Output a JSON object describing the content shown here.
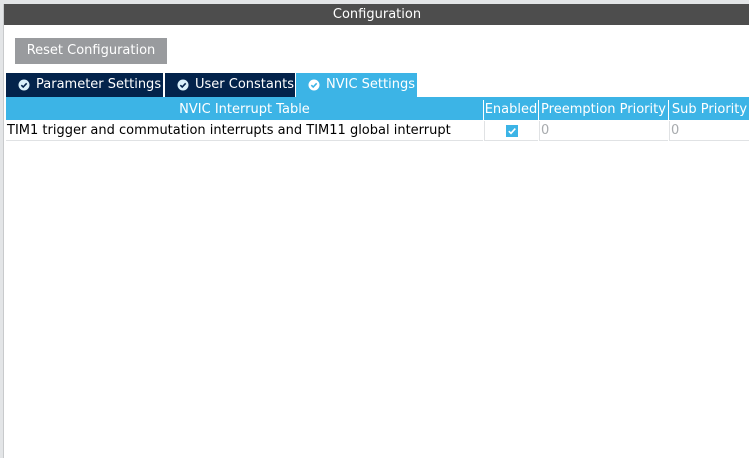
{
  "window": {
    "title": "Configuration"
  },
  "toolbar": {
    "reset_label": "Reset Configuration"
  },
  "tabs": [
    {
      "label": "Parameter Settings",
      "active": false,
      "icon": "check-circle-icon"
    },
    {
      "label": "User Constants",
      "active": false,
      "icon": "check-circle-icon"
    },
    {
      "label": "NVIC Settings",
      "active": true,
      "icon": "check-circle-icon"
    }
  ],
  "table": {
    "columns": [
      "NVIC Interrupt Table",
      "Enabled",
      "Preemption Priority",
      "Sub Priority"
    ],
    "rows": [
      {
        "name": "TIM1 trigger and commutation interrupts and TIM11 global interrupt",
        "enabled": true,
        "preemption_priority": "0",
        "sub_priority": "0"
      }
    ]
  },
  "colors": {
    "title_bar": "#4d4d4d",
    "tab_inactive": "#03234b",
    "accent": "#3cb4e6",
    "button": "#999b9e",
    "disabled_text": "#a8abae"
  }
}
